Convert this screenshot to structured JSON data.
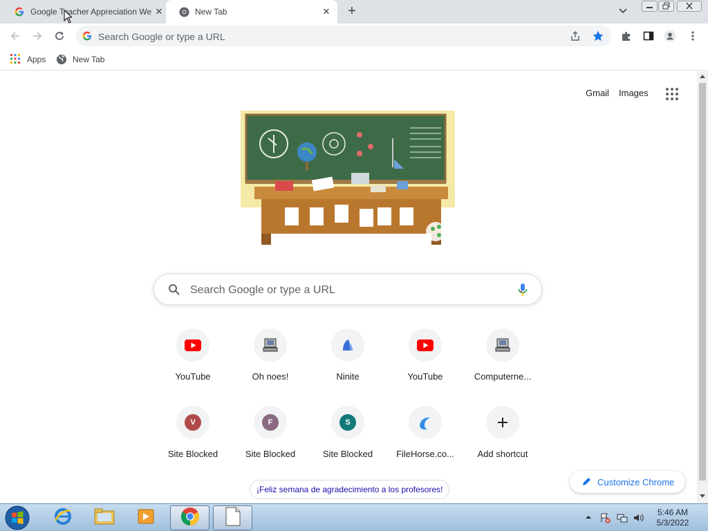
{
  "tabs": [
    {
      "title": "Google Teacher Appreciation We",
      "icon": "google-g-icon",
      "active": false
    },
    {
      "title": "New Tab",
      "icon": "chrome-icon",
      "active": true
    }
  ],
  "toolbar": {
    "omnibox_placeholder": "Search Google or type a URL"
  },
  "bookmarks": [
    {
      "label": "Apps",
      "icon": "apps-grid-icon"
    },
    {
      "label": "New Tab",
      "icon": "globe-icon"
    }
  ],
  "ntp": {
    "gmail_label": "Gmail",
    "images_label": "Images",
    "search_placeholder": "Search Google or type a URL",
    "shortcuts": [
      {
        "label": "YouTube",
        "icon": "youtube-icon"
      },
      {
        "label": "Oh noes!",
        "icon": "computer-icon"
      },
      {
        "label": "Ninite",
        "icon": "ninite-icon"
      },
      {
        "label": "YouTube",
        "icon": "youtube-icon"
      },
      {
        "label": "Computerne...",
        "icon": "computer-icon"
      },
      {
        "label": "Site Blocked",
        "letter": "V",
        "color": "#b04a4a"
      },
      {
        "label": "Site Blocked",
        "letter": "F",
        "color": "#8a6a80"
      },
      {
        "label": "Site Blocked",
        "letter": "S",
        "color": "#127a78"
      },
      {
        "label": "FileHorse.co...",
        "icon": "filehorse-icon"
      },
      {
        "label": "Add shortcut",
        "icon": "plus-icon"
      }
    ],
    "promo": "¡Feliz semana de agradecimiento a los profesores!",
    "customize_label": "Customize Chrome"
  },
  "taskbar": {
    "time": "5:46 AM",
    "date": "5/3/2022"
  },
  "colors": {
    "accent_blue": "#1a73e8",
    "youtube_red": "#ff0000",
    "chalkboard": "#3e6b47"
  }
}
